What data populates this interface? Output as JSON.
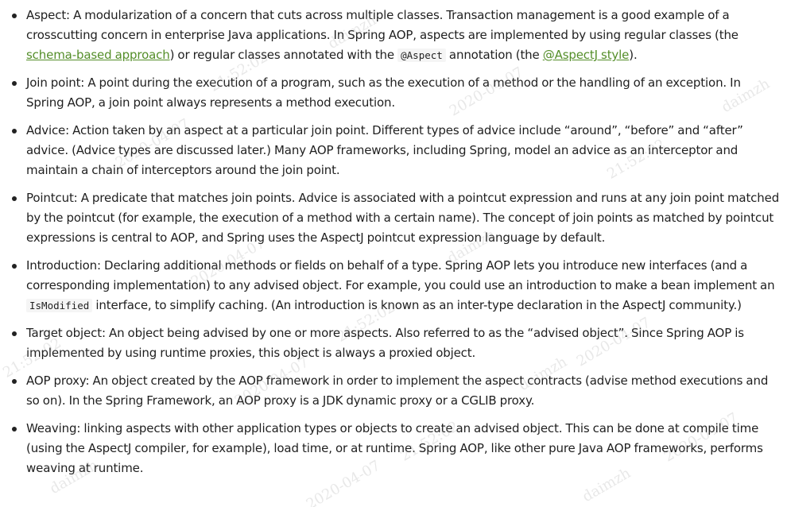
{
  "items": [
    {
      "id": "aspect",
      "pre": "Aspect: A modularization of a concern that cuts across multiple classes. Transaction management is a good example of a crosscutting concern in enterprise Java applications. In Spring AOP, aspects are implemented by using regular classes (the ",
      "link1": "schema-based approach",
      "mid1": ") or regular classes annotated with the ",
      "code": "@Aspect",
      "mid2": " annotation (the ",
      "link2": "@AspectJ style",
      "post": ")."
    },
    {
      "id": "join-point",
      "text": "Join point: A point during the execution of a program, such as the execution of a method or the handling of an exception. In Spring AOP, a join point always represents a method execution."
    },
    {
      "id": "advice",
      "text": "Advice: Action taken by an aspect at a particular join point. Different types of advice include “around”, “before” and “after” advice. (Advice types are discussed later.) Many AOP frameworks, including Spring, model an advice as an interceptor and maintain a chain of interceptors around the join point."
    },
    {
      "id": "pointcut",
      "text": "Pointcut: A predicate that matches join points. Advice is associated with a pointcut expression and runs at any join point matched by the pointcut (for example, the execution of a method with a certain name). The concept of join points as matched by pointcut expressions is central to AOP, and Spring uses the AspectJ pointcut expression language by default."
    },
    {
      "id": "introduction",
      "pre": "Introduction: Declaring additional methods or fields on behalf of a type. Spring AOP lets you introduce new interfaces (and a corresponding implementation) to any advised object. For example, you could use an introduction to make a bean implement an ",
      "code": "IsModified",
      "post": " interface, to simplify caching. (An introduction is known as an inter-type declaration in the AspectJ community.)"
    },
    {
      "id": "target-object",
      "text": "Target object: An object being advised by one or more aspects. Also referred to as the “advised object”. Since Spring AOP is implemented by using runtime proxies, this object is always a proxied object."
    },
    {
      "id": "aop-proxy",
      "text": "AOP proxy: An object created by the AOP framework in order to implement the aspect contracts (advise method executions and so on). In the Spring Framework, an AOP proxy is a JDK dynamic proxy or a CGLIB proxy."
    },
    {
      "id": "weaving",
      "text": "Weaving: linking aspects with other application types or objects to create an advised object. This can be done at compile time (using the AspectJ compiler, for example), load time, or at runtime. Spring AOP, like other pure Java AOP frameworks, performs weaving at runtime."
    }
  ],
  "colors": {
    "text": "#1f1f1f",
    "link": "#548e29",
    "watermark": "#969696"
  },
  "watermark": {
    "user": "daimzh",
    "date": "2020-04-07",
    "time": "21:52:02"
  }
}
